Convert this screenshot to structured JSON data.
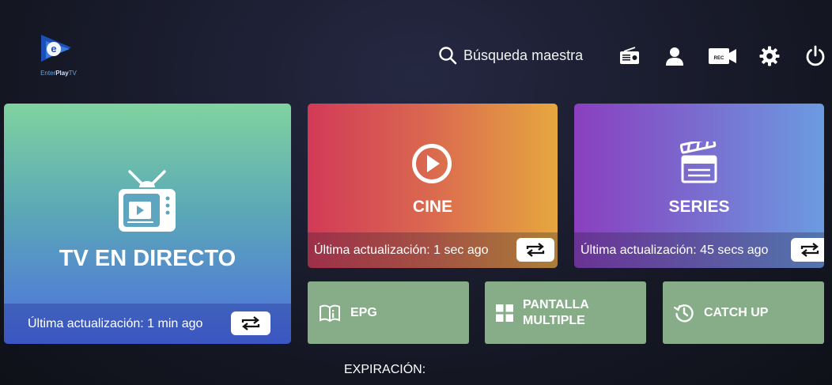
{
  "brand": {
    "logo_prefix": "Enter",
    "logo_bold": "Play",
    "logo_suffix": "TV"
  },
  "header": {
    "search_label": "Búsqueda maestra",
    "icons": [
      "radio-icon",
      "user-icon",
      "rec-camera-icon",
      "gear-icon",
      "power-icon"
    ],
    "rec_text": "REC"
  },
  "tiles": {
    "live": {
      "title": "TV EN DIRECTO",
      "updated": "Última actualización: 1 min ago"
    },
    "cine": {
      "title": "CINE",
      "updated": "Última actualización: 1 sec ago"
    },
    "series": {
      "title": "SERIES",
      "updated": "Última actualización: 45 secs ago"
    }
  },
  "shortcuts": {
    "epg": "EPG",
    "multi_line1": "PANTALLA",
    "multi_line2": "MULTIPLE",
    "catchup": "CATCH UP"
  },
  "footer": {
    "expiry_label": "EXPIRACIÓN:"
  }
}
